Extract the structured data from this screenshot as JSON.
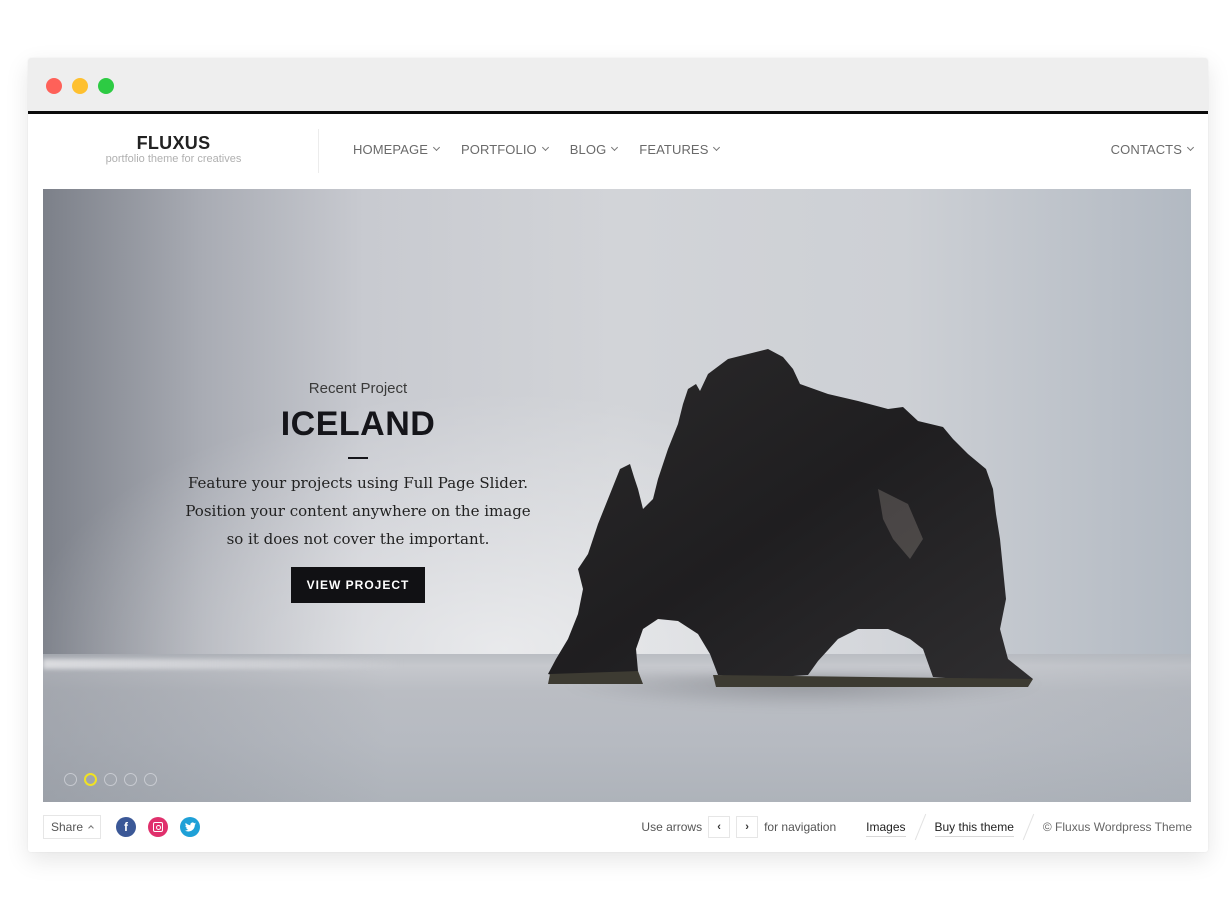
{
  "window": {
    "controls": [
      "close",
      "minimize",
      "maximize"
    ]
  },
  "header": {
    "logo_title": "FLUXUS",
    "logo_tagline": "portfolio theme for creatives",
    "nav": [
      {
        "label": "HOMEPAGE",
        "icon": "chevron-down-icon"
      },
      {
        "label": "PORTFOLIO",
        "icon": "chevron-down-icon"
      },
      {
        "label": "BLOG",
        "icon": "chevron-down-icon"
      },
      {
        "label": "FEATURES",
        "icon": "chevron-down-icon"
      }
    ],
    "nav_right": {
      "label": "CONTACTS",
      "icon": "chevron-down-icon"
    }
  },
  "slider": {
    "kicker": "Recent Project",
    "title": "ICELAND",
    "text_lines": [
      "Feature your projects using Full Page Slider.",
      "Position your content anywhere on the image",
      "so it does not cover the important."
    ],
    "button_label": "VIEW PROJECT",
    "slide_count": 5,
    "active_slide": 2,
    "accent_color": "#f0e223"
  },
  "footer": {
    "share_label": "Share",
    "social": [
      {
        "name": "facebook",
        "glyph": "f",
        "color": "#3b5897"
      },
      {
        "name": "instagram",
        "glyph": "",
        "color": "#e0306c"
      },
      {
        "name": "twitter",
        "glyph": "🐦",
        "color": "#1ea0d7"
      }
    ],
    "nav_hint_prefix": "Use arrows",
    "prev_glyph": "‹",
    "next_glyph": "›",
    "nav_hint_suffix": "for navigation",
    "images_link": "Images",
    "buy_link": "Buy this theme",
    "copyright": "© Fluxus Wordpress Theme"
  }
}
